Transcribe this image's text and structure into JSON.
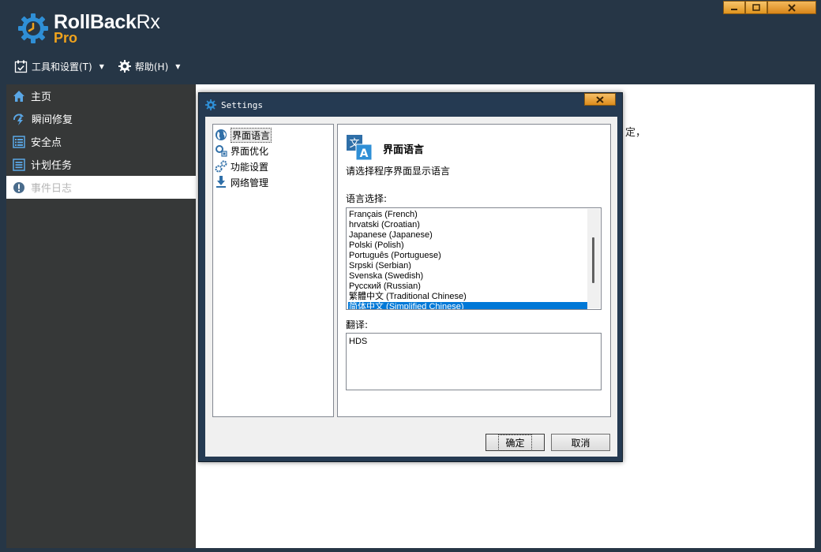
{
  "app": {
    "name_part1": "RollBack",
    "name_part2": "Rx",
    "edition": "Pro"
  },
  "menubar": [
    {
      "label": "工具和设置(T)",
      "icon": "calendar-check-icon"
    },
    {
      "label": "帮助(H)",
      "icon": "gear-icon"
    }
  ],
  "sidebar": {
    "items": [
      {
        "label": "主页",
        "icon": "home-icon"
      },
      {
        "label": "瞬间修复",
        "icon": "instant-restore-icon"
      },
      {
        "label": "安全点",
        "icon": "snapshot-list-icon"
      },
      {
        "label": "计划任务",
        "icon": "schedule-icon"
      },
      {
        "label": "事件日志",
        "icon": "alert-icon",
        "active": true
      }
    ]
  },
  "content": {
    "partial_text": "定，"
  },
  "dialog": {
    "title": "Settings",
    "tree": [
      {
        "label": "界面语言",
        "icon": "globe-icon",
        "selected": true
      },
      {
        "label": "界面优化",
        "icon": "ui-optimize-icon"
      },
      {
        "label": "功能设置",
        "icon": "gears-icon"
      },
      {
        "label": "网络管理",
        "icon": "download-icon"
      }
    ],
    "panel": {
      "title": "界面语言",
      "description": "请选择程序界面显示语言",
      "language_label": "语言选择:",
      "languages": [
        "Français (French)",
        "hrvatski (Croatian)",
        "Japanese (Japanese)",
        "Polski (Polish)",
        "Português (Portuguese)",
        "Srpski (Serbian)",
        "Svenska (Swedish)",
        "Русский (Russian)",
        "繁體中文 (Traditional Chinese)",
        "简体中文 (Simplified Chinese)"
      ],
      "selected_language_index": 9,
      "translation_label": "翻译:",
      "translation_value": "HDS"
    },
    "buttons": {
      "ok": "确定",
      "cancel": "取消"
    }
  },
  "colors": {
    "background": "#263646",
    "sidebar": "#363838",
    "accent": "#f0a31d",
    "selection": "#0078d7"
  }
}
